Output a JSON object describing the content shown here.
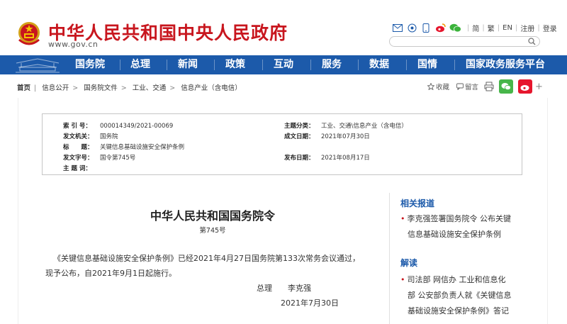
{
  "header": {
    "site_title": "中华人民共和国中央人民政府",
    "site_url": "www.gov.cn",
    "top_links": [
      "简",
      "繁",
      "EN",
      "注册",
      "登录"
    ],
    "search_placeholder": ""
  },
  "nav": {
    "items": [
      "国务院",
      "总理",
      "新闻",
      "政策",
      "互动",
      "服务",
      "数据",
      "国情",
      "国家政务服务平台"
    ]
  },
  "breadcrumb": [
    "首页",
    "信息公开",
    "国务院文件",
    "工业、交通",
    "信息产业（含电信）"
  ],
  "tools": {
    "favorite": "收藏",
    "print": "留言"
  },
  "meta": {
    "index_label": "索 引 号：",
    "index_value": "000014349/2021-00069",
    "topic_label": "主题分类：",
    "topic_value": "工业、交通\\信息产业（含电信）",
    "issuer_label": "发文机关：",
    "issuer_value": "国务院",
    "created_label": "成文日期：",
    "created_value": "2021年07月30日",
    "title_label": "标　　题：",
    "title_value": "关键信息基础设施安全保护条例",
    "doc_no_label": "发文字号：",
    "doc_no_value": "国令第745号",
    "published_label": "发布日期：",
    "published_value": "2021年08月17日",
    "keywords_label": "主 题 词：",
    "keywords_value": ""
  },
  "document": {
    "title": "中华人民共和国国务院令",
    "number": "第745号",
    "para1": "《关键信息基础设施安全保护条例》已经2021年4月27日国务院第133次常务会议通过，",
    "para2": "现予公布，自2021年9月1日起施行。",
    "signer": "总理　　李克强",
    "date": "2021年7月30日"
  },
  "sidebar": {
    "related_head": "相关报道",
    "related_line1": "李克强签署国务院令 公布关键",
    "related_line2": "信息基础设施安全保护条例",
    "interpret_head": "解读",
    "interpret_line1": "司法部 网信办 工业和信息化",
    "interpret_line2": "部 公安部负责人就《关键信息",
    "interpret_line3": "基础设施安全保护条例》答记"
  },
  "colors": {
    "brand_red": "#c8161e",
    "nav_blue": "#1c5aaa"
  }
}
